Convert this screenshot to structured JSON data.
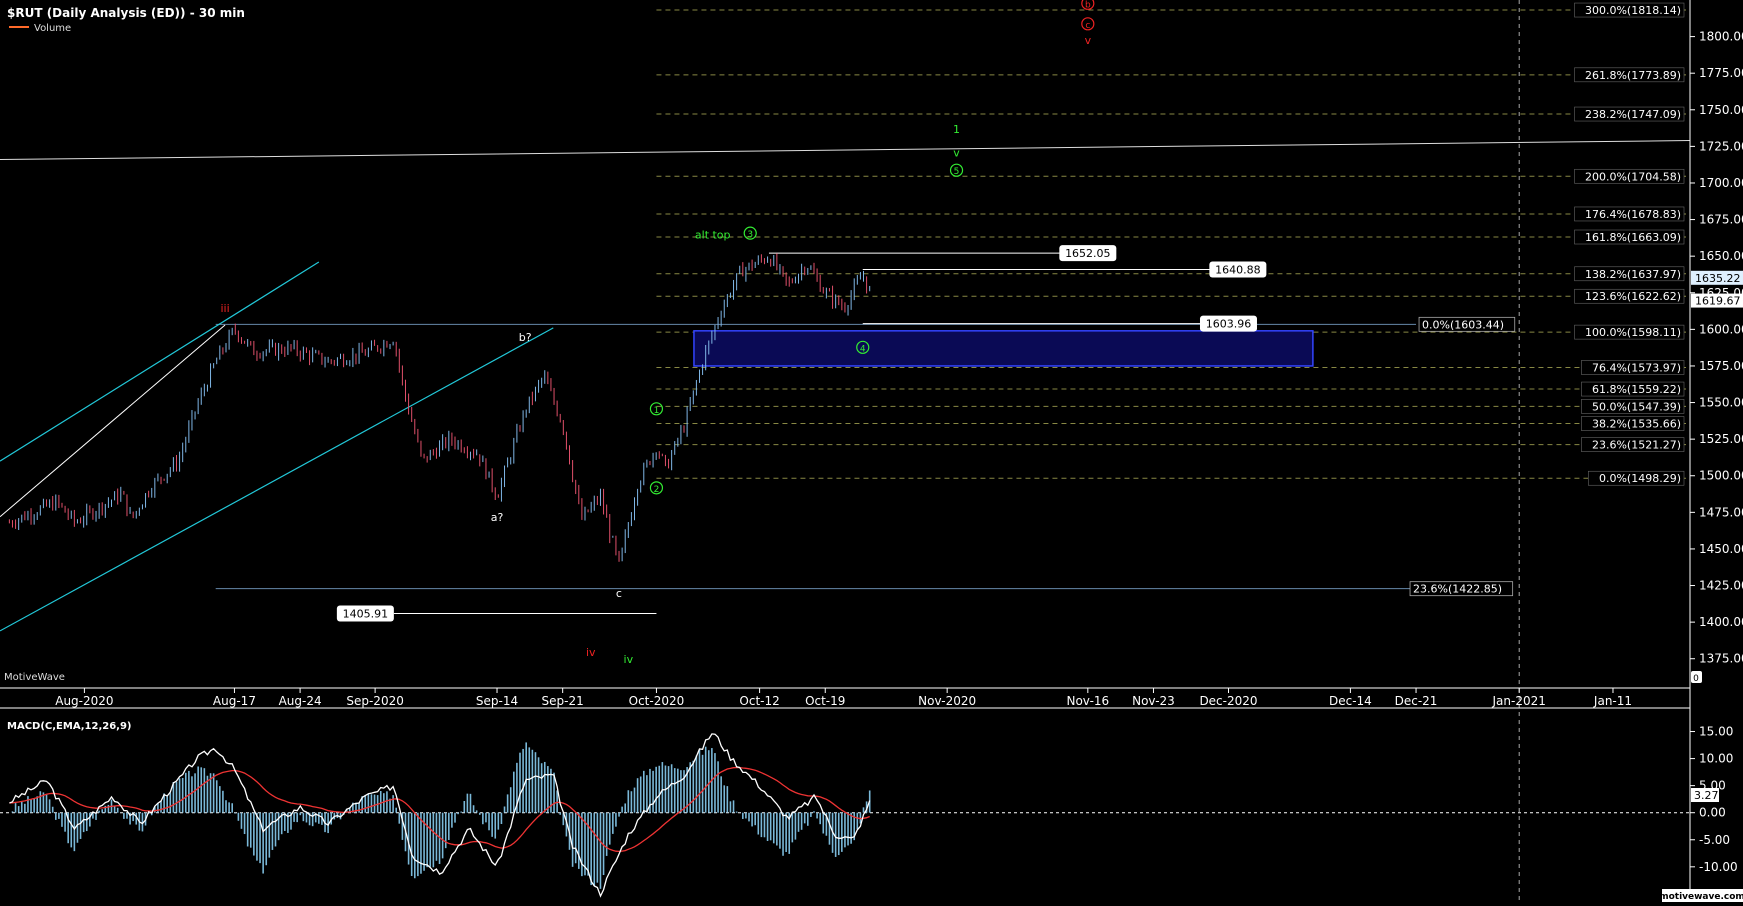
{
  "title": "$RUT (Daily Analysis (ED)) - 30 min",
  "legend": {
    "volume_label": "Volume",
    "volume_color": "#ff6a2a"
  },
  "watermark": "MotiveWave",
  "footer_logo": "motivewave.com",
  "right_axis_extra": "0",
  "colors": {
    "background": "#000000",
    "candle_up": "#7fb6e6",
    "candle_down": "#e0506a",
    "fib_line": "#888844",
    "channel": "#22c8d8",
    "green_label": "#33ee33",
    "red_label": "#ee2222",
    "macd_hist": "#7ab8d8",
    "macd_line": "#ffffff",
    "signal_line": "#ee3333",
    "box_fill": "#0a0a55",
    "box_stroke": "#3344ff"
  },
  "chart_data": [
    {
      "type": "candlestick",
      "title": "$RUT (Daily Analysis (ED)) - 30 min",
      "ylim": [
        1355,
        1825
      ],
      "y_ticks": [
        1375,
        1400,
        1425,
        1450,
        1475,
        1500,
        1525,
        1550,
        1575,
        1600,
        1625,
        1650,
        1675,
        1700,
        1725,
        1750,
        1775,
        1800
      ],
      "x_labels": [
        "Aug-2020",
        "Aug-17",
        "Aug-24",
        "Sep-2020",
        "Sep-14",
        "Sep-21",
        "Oct-2020",
        "Oct-12",
        "Oct-19",
        "Nov-2020",
        "Nov-16",
        "Nov-23",
        "Dec-2020",
        "Dec-14",
        "Dec-21",
        "Jan-2021",
        "Jan-11"
      ],
      "x_range": [
        "2020-07-23",
        "2021-01-19"
      ],
      "path_points": [
        [
          "2020-07-24",
          1468
        ],
        [
          "2020-07-29",
          1482
        ],
        [
          "2020-07-31",
          1468
        ],
        [
          "2020-08-03",
          1480
        ],
        [
          "2020-08-05",
          1488
        ],
        [
          "2020-08-06",
          1470
        ],
        [
          "2020-08-08",
          1492
        ],
        [
          "2020-08-11",
          1510
        ],
        [
          "2020-08-13",
          1548
        ],
        [
          "2020-08-15",
          1578
        ],
        [
          "2020-08-17",
          1600
        ],
        [
          "2020-08-19",
          1585
        ],
        [
          "2020-08-23",
          1587
        ],
        [
          "2020-08-27",
          1578
        ],
        [
          "2020-08-31",
          1584
        ],
        [
          "2020-09-03",
          1594
        ],
        [
          "2020-09-04",
          1560
        ],
        [
          "2020-09-06",
          1510
        ],
        [
          "2020-09-09",
          1525
        ],
        [
          "2020-09-12",
          1515
        ],
        [
          "2020-09-14",
          1486
        ],
        [
          "2020-09-17",
          1545
        ],
        [
          "2020-09-19",
          1568
        ],
        [
          "2020-09-21",
          1535
        ],
        [
          "2020-09-23",
          1470
        ],
        [
          "2020-09-25",
          1486
        ],
        [
          "2020-09-27",
          1438
        ],
        [
          "2020-09-29",
          1495
        ],
        [
          "2020-10-01",
          1520
        ],
        [
          "2020-10-02",
          1505
        ],
        [
          "2020-10-04",
          1535
        ],
        [
          "2020-10-06",
          1580
        ],
        [
          "2020-10-08",
          1615
        ],
        [
          "2020-10-10",
          1640
        ],
        [
          "2020-10-13",
          1650
        ],
        [
          "2020-10-15",
          1630
        ],
        [
          "2020-10-17",
          1645
        ],
        [
          "2020-10-19",
          1625
        ],
        [
          "2020-10-21",
          1615
        ],
        [
          "2020-10-23",
          1638
        ],
        [
          "2020-10-24",
          1620
        ]
      ],
      "fib_levels": [
        {
          "label": "300.0%(1818.14)",
          "value": 1818.14
        },
        {
          "label": "261.8%(1773.89)",
          "value": 1773.89
        },
        {
          "label": "238.2%(1747.09)",
          "value": 1747.09
        },
        {
          "label": "200.0%(1704.58)",
          "value": 1704.58
        },
        {
          "label": "176.4%(1678.83)",
          "value": 1678.83
        },
        {
          "label": "161.8%(1663.09)",
          "value": 1663.09
        },
        {
          "label": "138.2%(1637.97)",
          "value": 1637.97
        },
        {
          "label": "123.6%(1622.62)",
          "value": 1622.62
        },
        {
          "label": "100.0%(1598.11)",
          "value": 1598.11
        },
        {
          "label": "76.4%(1573.97)",
          "value": 1573.97
        },
        {
          "label": "61.8%(1559.22)",
          "value": 1559.22
        },
        {
          "label": "50.0%(1547.39)",
          "value": 1547.39
        },
        {
          "label": "38.2%(1535.66)",
          "value": 1535.66
        },
        {
          "label": "23.6%(1521.27)",
          "value": 1521.27
        },
        {
          "label": "0.0%(1498.29)",
          "value": 1498.29
        }
      ],
      "extra_fibs": [
        {
          "label": "0.0%(1603.44)",
          "value": 1603.44
        },
        {
          "label": "23.6%(1422.85)",
          "value": 1422.85
        }
      ],
      "price_labels": [
        {
          "label": "1652.05",
          "value": 1652.05
        },
        {
          "label": "1640.88",
          "value": 1640.88
        },
        {
          "label": "1603.96",
          "value": 1603.96
        },
        {
          "label": "1405.91",
          "value": 1405.91
        }
      ],
      "last_prices": [
        {
          "label": "1635.22",
          "value": 1635.22
        },
        {
          "label": "1619.67",
          "value": 1619.67
        }
      ],
      "wave_labels": [
        {
          "text": "iii",
          "date": "2020-08-16",
          "value": 1612,
          "color": "red"
        },
        {
          "text": "b?",
          "date": "2020-09-17",
          "value": 1592,
          "color": "white"
        },
        {
          "text": "a?",
          "date": "2020-09-14",
          "value": 1469,
          "color": "white"
        },
        {
          "text": "c",
          "date": "2020-09-27",
          "value": 1417,
          "color": "white"
        },
        {
          "text": "iv",
          "date": "2020-09-24",
          "value": 1377,
          "color": "red"
        },
        {
          "text": "iv",
          "date": "2020-09-28",
          "value": 1372,
          "color": "green"
        },
        {
          "text": "1",
          "date": "2020-10-01",
          "value": 1543,
          "color": "green",
          "circled": true
        },
        {
          "text": "2",
          "date": "2020-10-01",
          "value": 1489,
          "color": "green",
          "circled": true
        },
        {
          "text": "3",
          "date": "2020-10-11",
          "value": 1663,
          "color": "green",
          "circled": true
        },
        {
          "text": "alt top",
          "date": "2020-10-07",
          "value": 1662,
          "color": "green"
        },
        {
          "text": "4",
          "date": "2020-10-23",
          "value": 1585,
          "color": "green",
          "circled": true
        },
        {
          "text": "5",
          "date": "2020-11-02",
          "value": 1706,
          "color": "green",
          "circled": true
        },
        {
          "text": "v",
          "date": "2020-11-02",
          "value": 1718,
          "color": "green"
        },
        {
          "text": "1",
          "date": "2020-11-02",
          "value": 1734,
          "color": "green"
        },
        {
          "text": "b",
          "date": "2020-11-16",
          "value": 1820,
          "color": "red",
          "circled": true
        },
        {
          "text": "c",
          "date": "2020-11-16",
          "value": 1806,
          "color": "red",
          "circled": true
        },
        {
          "text": "v",
          "date": "2020-11-16",
          "value": 1795,
          "color": "red"
        }
      ],
      "target_box": {
        "x_from": "2020-10-05",
        "x_to": "2020-12-10",
        "y_from": 1575,
        "y_to": 1599
      }
    },
    {
      "type": "line",
      "title": "MACD(C,EMA,12,26,9)",
      "ylim": [
        -16.5,
        17.5
      ],
      "y_ticks": [
        15,
        10,
        5,
        0,
        -5,
        -10,
        -15
      ],
      "y_tick_labels": [
        "15.00",
        "10.00",
        "5.00",
        "0.00",
        "-5.00",
        "-10.00",
        "-15.00"
      ],
      "last_value": "3.27",
      "macd_points": [
        [
          "2020-07-24",
          2
        ],
        [
          "2020-07-28",
          6
        ],
        [
          "2020-07-31",
          -3
        ],
        [
          "2020-08-04",
          3
        ],
        [
          "2020-08-07",
          -2
        ],
        [
          "2020-08-10",
          4
        ],
        [
          "2020-08-13",
          10
        ],
        [
          "2020-08-15",
          12
        ],
        [
          "2020-08-17",
          8
        ],
        [
          "2020-08-20",
          -3
        ],
        [
          "2020-08-24",
          1
        ],
        [
          "2020-08-27",
          -2
        ],
        [
          "2020-08-31",
          3
        ],
        [
          "2020-09-03",
          5
        ],
        [
          "2020-09-05",
          -8
        ],
        [
          "2020-09-08",
          -11
        ],
        [
          "2020-09-11",
          -3
        ],
        [
          "2020-09-14",
          -10
        ],
        [
          "2020-09-17",
          6
        ],
        [
          "2020-09-20",
          7
        ],
        [
          "2020-09-22",
          -6
        ],
        [
          "2020-09-25",
          -15
        ],
        [
          "2020-09-28",
          -4
        ],
        [
          "2020-10-01",
          3
        ],
        [
          "2020-10-04",
          7
        ],
        [
          "2020-10-07",
          15
        ],
        [
          "2020-10-09",
          10
        ],
        [
          "2020-10-12",
          5
        ],
        [
          "2020-10-15",
          -1
        ],
        [
          "2020-10-18",
          3
        ],
        [
          "2020-10-20",
          -4
        ],
        [
          "2020-10-22",
          -5
        ],
        [
          "2020-10-24",
          3
        ]
      ]
    }
  ]
}
